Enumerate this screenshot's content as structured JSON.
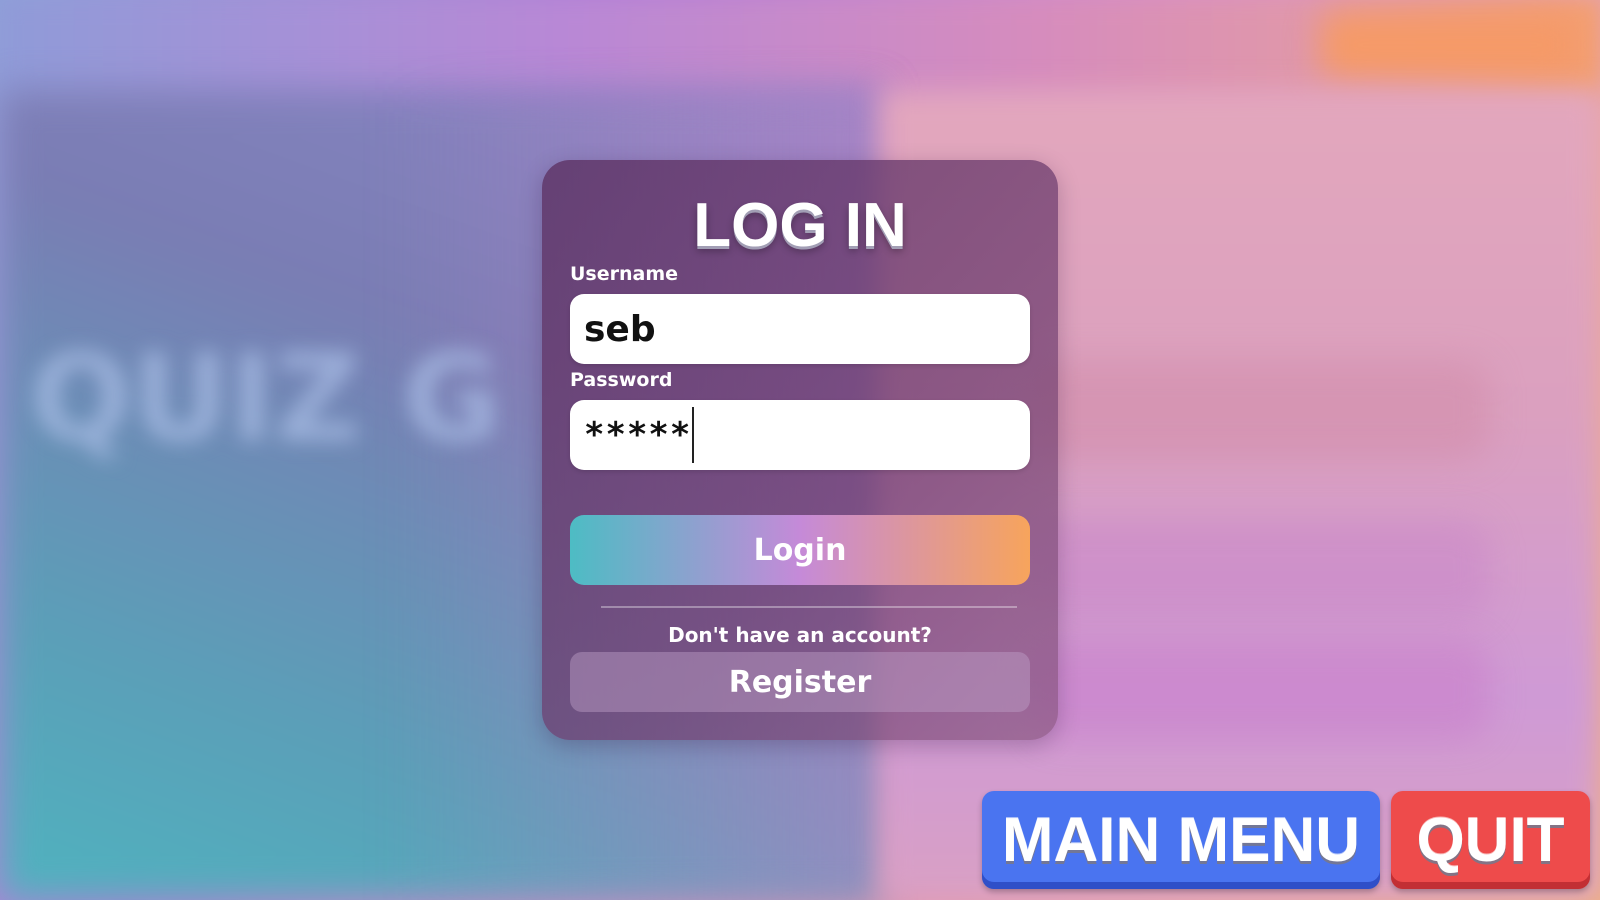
{
  "background": {
    "blurred_title": "QUIZ G"
  },
  "login_card": {
    "title": "LOG IN",
    "username": {
      "label": "Username",
      "value": "seb"
    },
    "password": {
      "label": "Password",
      "value": "*****"
    },
    "login_button": "Login",
    "register_prompt": "Don't have an account?",
    "register_button": "Register"
  },
  "bottom_bar": {
    "main_menu_button": "MAIN MENU",
    "quit_button": "QUIT"
  },
  "colors": {
    "main_menu": "#4a74f0",
    "quit": "#ee4b4b",
    "login_gradient": [
      "#4dbcc4",
      "#c58ad8",
      "#f7a45c"
    ]
  }
}
